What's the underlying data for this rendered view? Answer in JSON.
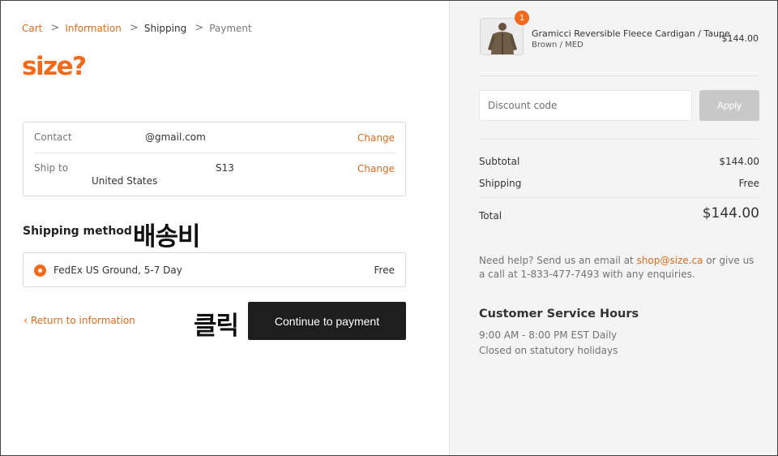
{
  "breadcrumb": {
    "items": [
      "Cart",
      "Information",
      "Shipping",
      "Payment"
    ],
    "separator": ">"
  },
  "logo": {
    "text": "size?",
    "color": "#f26b1d"
  },
  "contact": {
    "label": "Contact",
    "value": "@gmail.com",
    "change_label": "Change"
  },
  "ship_to": {
    "label": "Ship to",
    "value_line1": "S13",
    "value_line2": "United States",
    "change_label": "Change"
  },
  "shipping_method": {
    "title": "Shipping method",
    "annotation": "배송비",
    "option": {
      "name": "FedEx US Ground, 5-7 Day",
      "price": "Free",
      "selected": true
    }
  },
  "actions": {
    "return_label": "Return to information",
    "annotation": "클릭",
    "continue_label": "Continue to payment"
  },
  "order": {
    "item": {
      "quantity": "1",
      "name": "Gramicci Reversible Fleece Cardigan / Taupe",
      "variant": "Brown / MED",
      "price": "$144.00"
    },
    "discount": {
      "placeholder": "Discount code",
      "apply_label": "Apply"
    },
    "subtotal": {
      "label": "Subtotal",
      "value": "$144.00"
    },
    "shipping": {
      "label": "Shipping",
      "value": "Free"
    },
    "total": {
      "label": "Total",
      "value": "$144.00"
    }
  },
  "help": {
    "text_before": "Need help? Send us an email at ",
    "email": "shop@size.ca",
    "text_after": " or give us a call at 1-833-477-7493 with any enquiries."
  },
  "hours": {
    "title": "Customer Service Hours",
    "line1": "9:00 AM - 8:00 PM EST Daily",
    "line2": "Closed on statutory holidays"
  },
  "colors": {
    "accent": "#f26b1d",
    "link": "#d96c1f",
    "button_dark": "#1e1e1e",
    "sidebar_bg": "#f4f4f4"
  }
}
